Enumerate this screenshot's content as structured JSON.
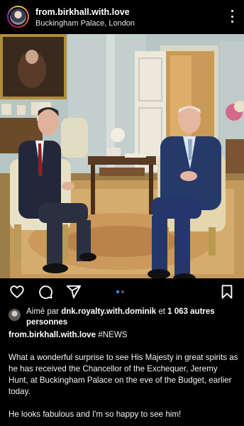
{
  "header": {
    "username": "from.birkhall.with.love",
    "location": "Buckingham Palace, London"
  },
  "likes": {
    "prefix": "Aimé par ",
    "user": "dnk.royalty.with.dominik",
    "middle": " et ",
    "count": "1 063 autres personnes"
  },
  "caption": {
    "username": "from.birkhall.with.love",
    "hashtag": "#NEWS",
    "paragraph1": "What a wonderful surprise to see His Majesty in great spirits as he has received the Chancellor of the Exchequer, Jeremy Hunt, at Buckingham Palace on the eve of the Budget, earlier today.",
    "paragraph2": "He looks fabulous and I'm so happy to see him!"
  },
  "carousel": {
    "current": 1,
    "total": 2
  },
  "colors": {
    "background": "#000000",
    "accent": "#3897f0"
  }
}
